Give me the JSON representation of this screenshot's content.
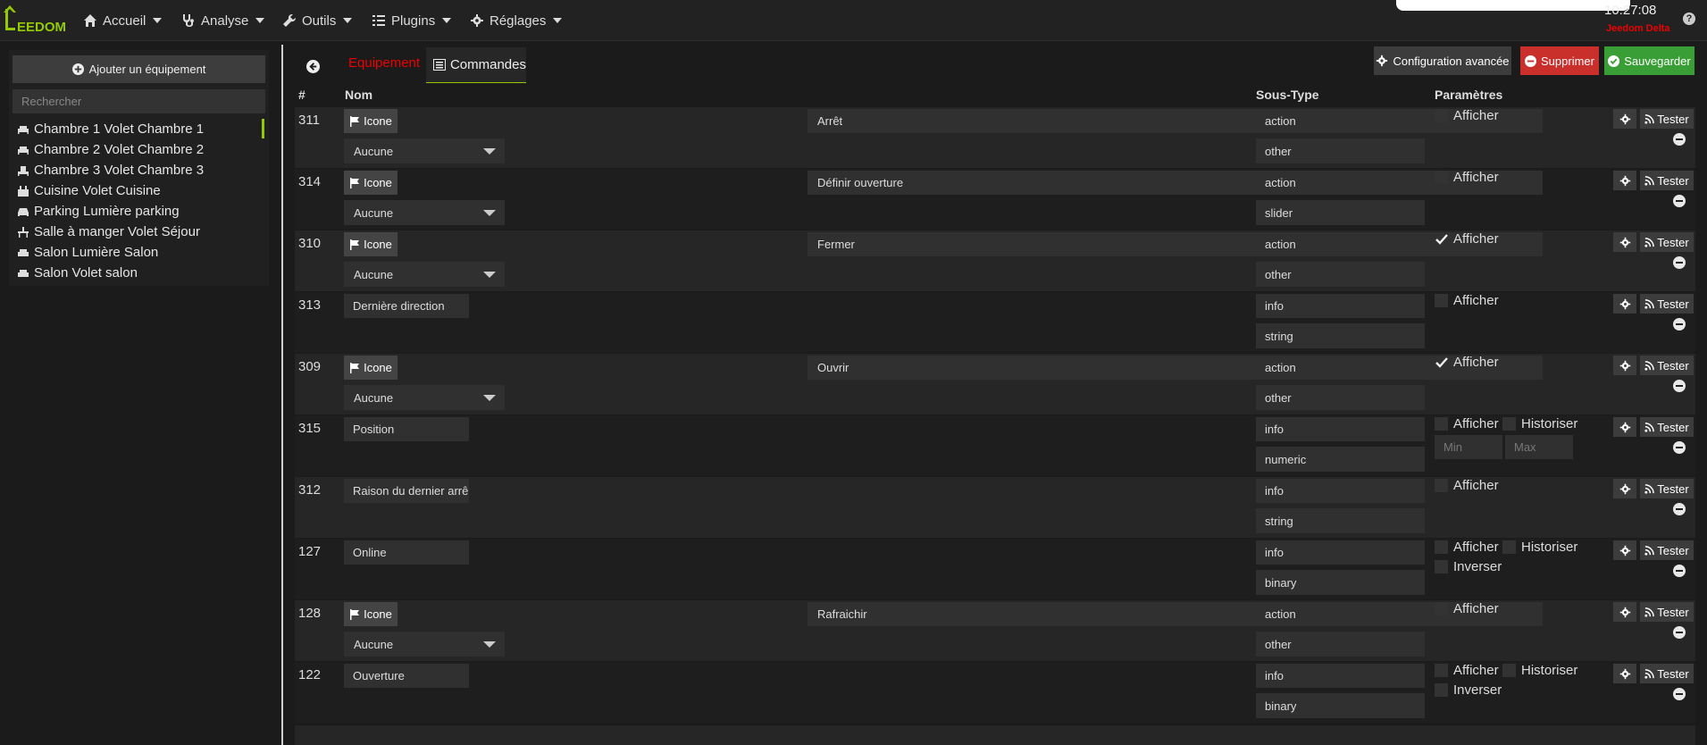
{
  "nav": {
    "brand": "EEDOM",
    "menu": [
      {
        "label": "Accueil",
        "icon": "home-icon"
      },
      {
        "label": "Analyse",
        "icon": "stethoscope-icon"
      },
      {
        "label": "Outils",
        "icon": "wrench-icon"
      },
      {
        "label": "Plugins",
        "icon": "tasks-icon"
      },
      {
        "label": "Réglages",
        "icon": "cogs-icon"
      }
    ],
    "time": "10:27:08",
    "instance": "Jeedom Delta",
    "help": "?"
  },
  "sidebar": {
    "add_label": "Ajouter un équipement",
    "search_placeholder": "Rechercher",
    "items": [
      {
        "label": "Chambre 1 Volet Chambre 1",
        "icon": "bed-icon"
      },
      {
        "label": "Chambre 2 Volet Chambre 2",
        "icon": "bed-icon"
      },
      {
        "label": "Chambre 3 Volet Chambre 3",
        "icon": "child-bed-icon"
      },
      {
        "label": "Cuisine Volet Cuisine",
        "icon": "kitchen-icon"
      },
      {
        "label": "Parking Lumière parking",
        "icon": "car-icon"
      },
      {
        "label": "Salle à manger Volet Séjour",
        "icon": "dining-icon"
      },
      {
        "label": "Salon Lumière Salon",
        "icon": "sofa-icon"
      },
      {
        "label": "Salon Volet salon",
        "icon": "sofa-icon"
      }
    ]
  },
  "tabs": {
    "equipement": "Equipement",
    "commandes": "Commandes"
  },
  "actions": {
    "config": "Configuration avancée",
    "delete": "Supprimer",
    "save": "Sauvegarder"
  },
  "table": {
    "headers": {
      "id": "#",
      "nom": "Nom",
      "soustype": "Sous-Type",
      "params": "Paramètres"
    },
    "icon_label": "Icone",
    "none_label": "Aucune",
    "test_label": "Tester",
    "afficher": "Afficher",
    "historiser": "Historiser",
    "inverser": "Inverser",
    "min": "Min",
    "max": "Max",
    "rows": [
      {
        "id": "311",
        "name": "Arrêt",
        "type": "action",
        "subtype": "other",
        "afficher": false
      },
      {
        "id": "314",
        "name": "Définir ouverture",
        "type": "action",
        "subtype": "slider",
        "afficher": false
      },
      {
        "id": "310",
        "name": "Fermer",
        "type": "action",
        "subtype": "other",
        "afficher": true
      },
      {
        "id": "313",
        "name": "Dernière direction",
        "type": "info",
        "subtype": "string",
        "afficher": false
      },
      {
        "id": "309",
        "name": "Ouvrir",
        "type": "action",
        "subtype": "other",
        "afficher": true
      },
      {
        "id": "315",
        "name": "Position",
        "type": "info",
        "subtype": "numeric",
        "afficher": false
      },
      {
        "id": "312",
        "name": "Raison du dernier arrê",
        "type": "info",
        "subtype": "string",
        "afficher": false
      },
      {
        "id": "127",
        "name": "Online",
        "type": "info",
        "subtype": "binary",
        "afficher": false
      },
      {
        "id": "128",
        "name": "Rafraichir",
        "type": "action",
        "subtype": "other",
        "afficher": false
      },
      {
        "id": "122",
        "name": "Ouverture",
        "type": "info",
        "subtype": "binary",
        "afficher": false
      }
    ]
  },
  "colors": {
    "accent": "#94ca02",
    "danger": "#c9302c",
    "success": "#3a9e36",
    "tab_red": "#ee0000"
  }
}
